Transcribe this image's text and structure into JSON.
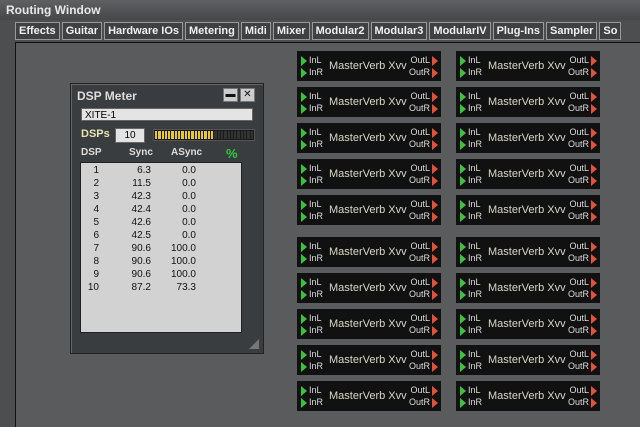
{
  "window": {
    "title": "Routing Window"
  },
  "tabs": [
    "Effects",
    "Guitar",
    "Hardware IOs",
    "Metering",
    "Midi",
    "Mixer",
    "Modular2",
    "Modular3",
    "ModularIV",
    "Plug-Ins",
    "Sampler",
    "So"
  ],
  "module": {
    "name": "MasterVerb Xvv",
    "in_l": "InL",
    "in_r": "InR",
    "out_l": "OutL",
    "out_r": "OutR"
  },
  "module_count": 20,
  "dsp_meter": {
    "title": "DSP Meter",
    "device": "XITE-1",
    "dsps_label": "DSPs",
    "dsps_value": "10",
    "load_percent": 60,
    "headers": {
      "dsp": "DSP",
      "sync": "Sync",
      "async": "ASync"
    },
    "rows": [
      [
        "1",
        "6.3",
        "0.0"
      ],
      [
        "2",
        "11.5",
        "0.0"
      ],
      [
        "3",
        "42.3",
        "0.0"
      ],
      [
        "4",
        "42.4",
        "0.0"
      ],
      [
        "5",
        "42.6",
        "0.0"
      ],
      [
        "6",
        "42.5",
        "0.0"
      ],
      [
        "7",
        "90.6",
        "100.0"
      ],
      [
        "8",
        "90.6",
        "100.0"
      ],
      [
        "9",
        "90.6",
        "100.0"
      ],
      [
        "10",
        "87.2",
        "73.3"
      ]
    ]
  },
  "colors": {
    "input_arrow": "#3ec23e",
    "output_arrow": "#e0523a",
    "meter_fill": "#e8c838"
  }
}
